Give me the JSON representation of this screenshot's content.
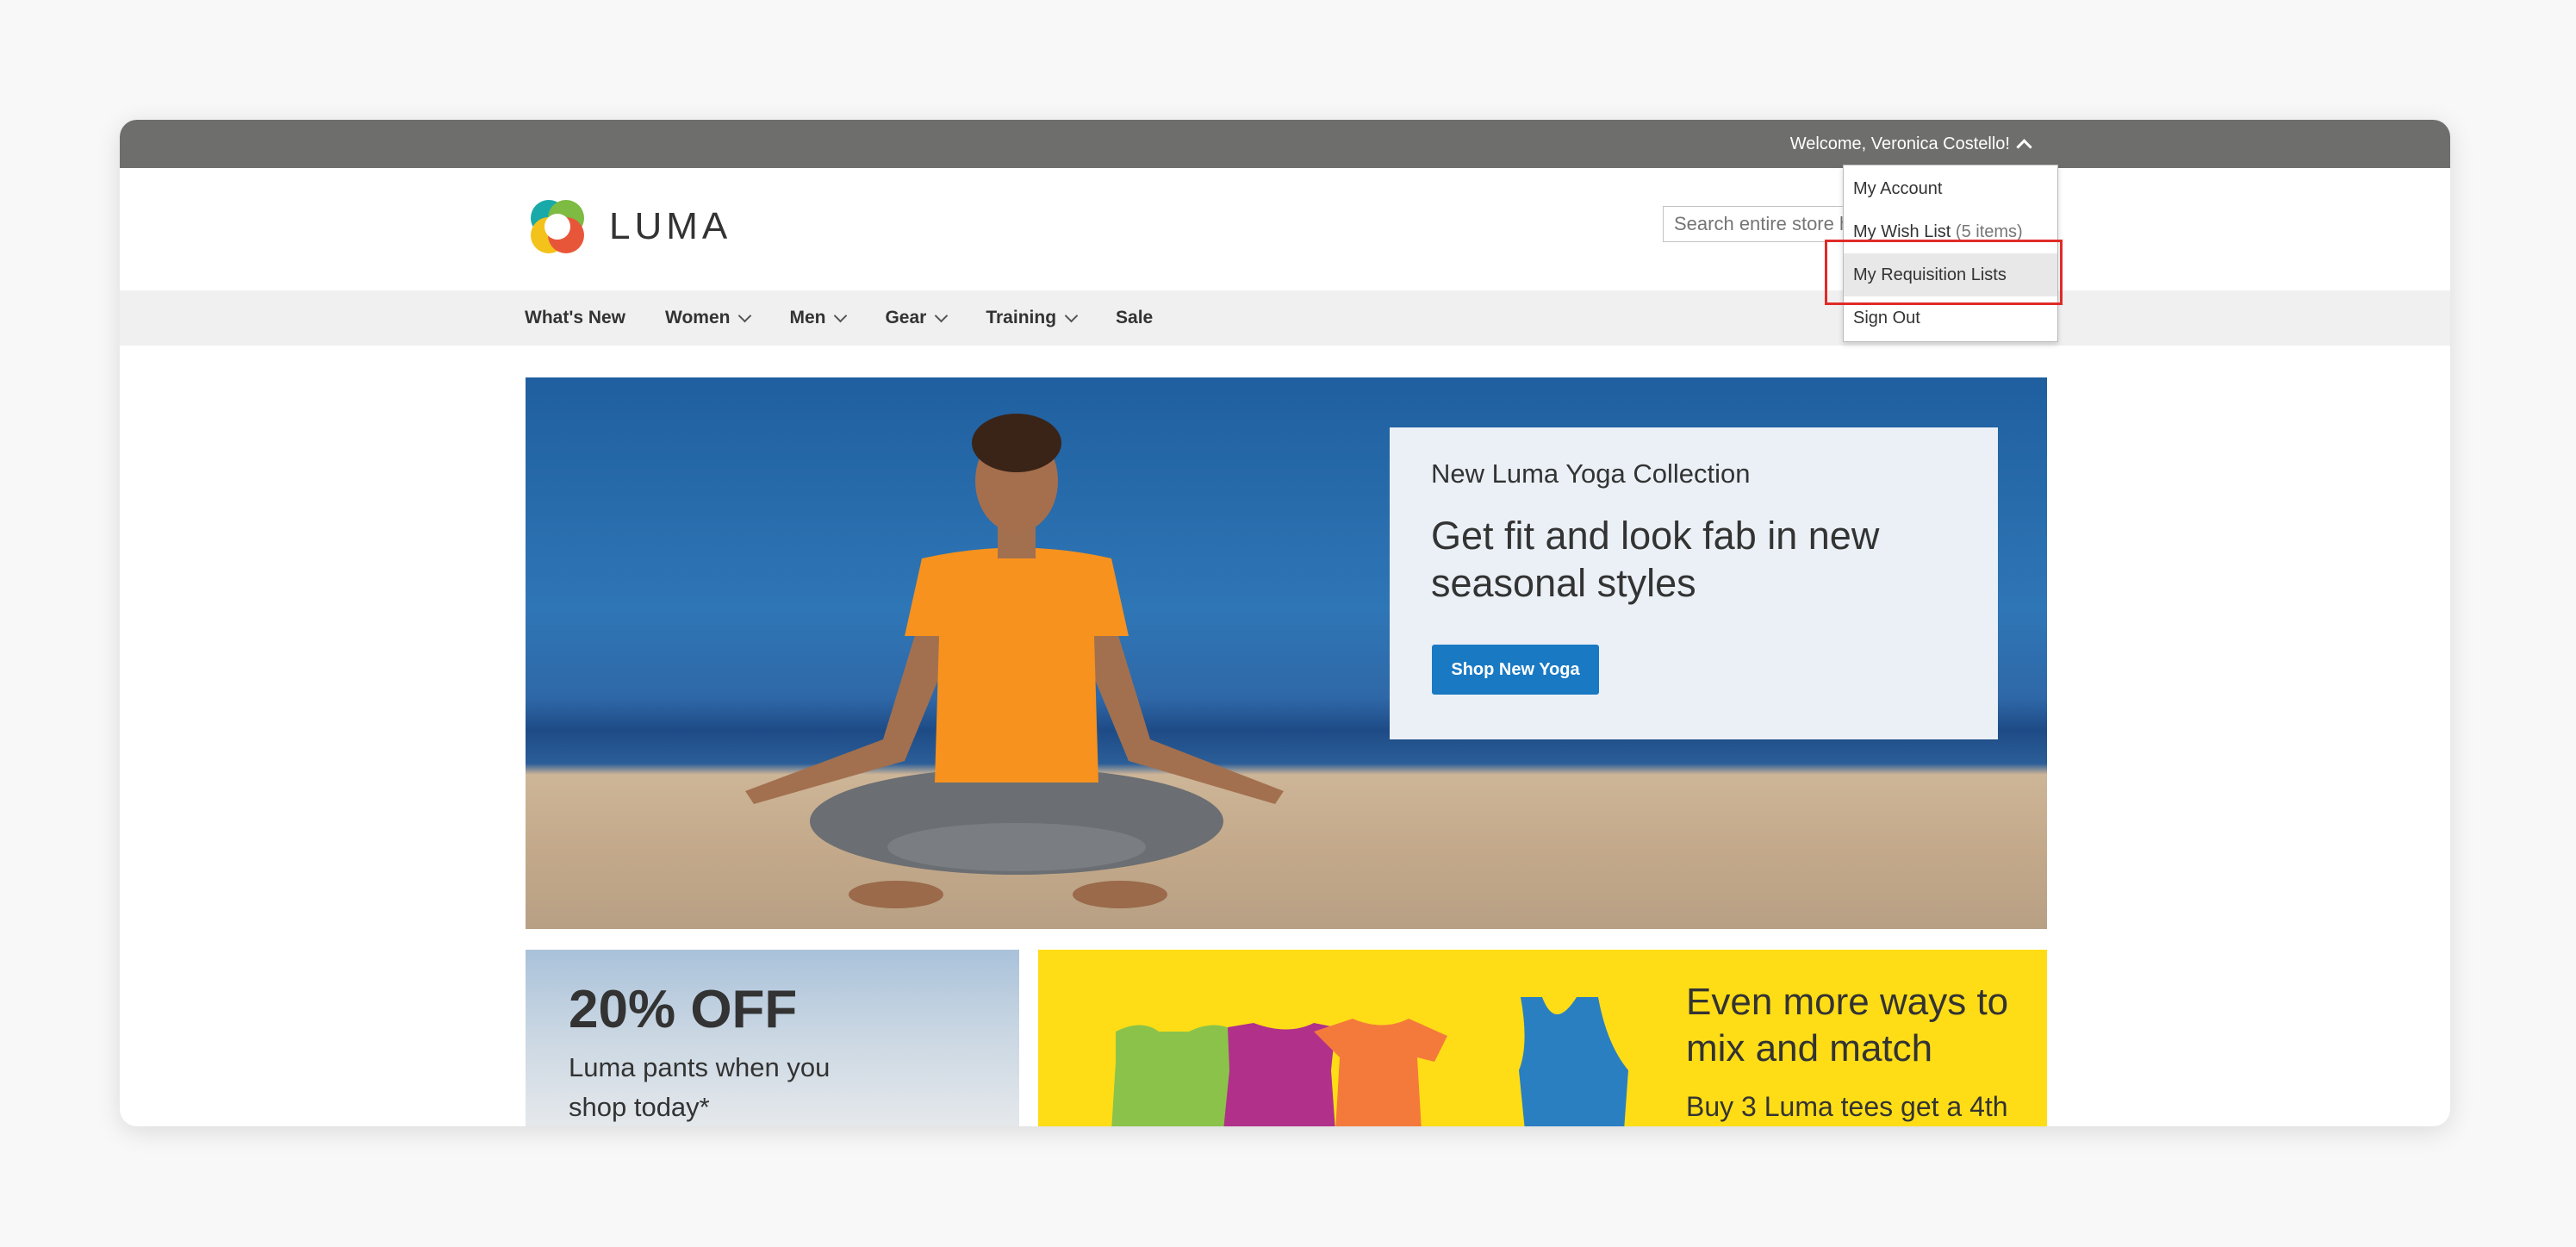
{
  "header": {
    "welcome_text": "Welcome, Veronica Costello!",
    "logo_text": "LUMA",
    "search_placeholder": "Search entire store here..."
  },
  "account_menu": {
    "items": [
      {
        "label": "My Account"
      },
      {
        "label": "My Wish List",
        "count": "(5 items)"
      },
      {
        "label": "My Requisition Lists"
      },
      {
        "label": "Sign Out"
      }
    ]
  },
  "nav": {
    "items": [
      {
        "label": "What's New"
      },
      {
        "label": "Women"
      },
      {
        "label": "Men"
      },
      {
        "label": "Gear"
      },
      {
        "label": "Training"
      },
      {
        "label": "Sale"
      }
    ]
  },
  "hero": {
    "subtitle": "New Luma Yoga Collection",
    "title": "Get fit and look fab in new seasonal styles",
    "button_label": "Shop New Yoga"
  },
  "tiles": {
    "pants": {
      "headline": "20% OFF",
      "text": "Luma pants when you shop today*"
    },
    "tees": {
      "headline": "Even more ways to mix and match",
      "text": "Buy 3 Luma tees get a 4th"
    }
  },
  "colors": {
    "topbar": "#6e6f6c",
    "nav_bg": "#f0f0f0",
    "accent_blue": "#1979c3",
    "highlight": "#e02b27",
    "tile_yellow": "#ffdd16"
  }
}
